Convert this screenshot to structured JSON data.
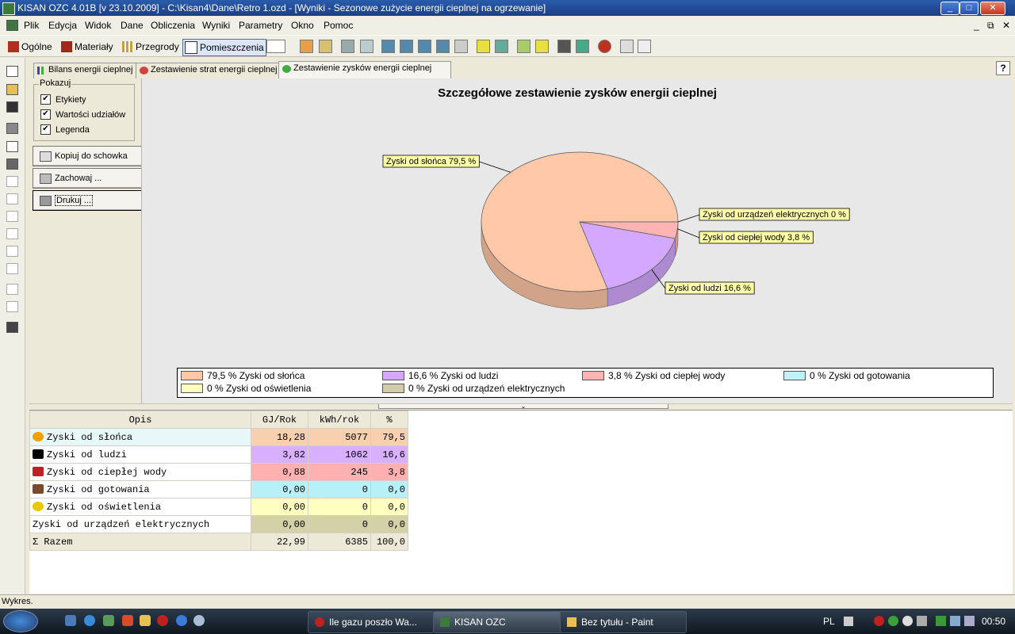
{
  "window": {
    "title": "KISAN OZC 4.01B [v 23.10.2009] - C:\\Kisan4\\Dane\\Retro 1.ozd - [Wyniki - Sezonowe zużycie energii cieplnej na ogrzewanie]"
  },
  "menu": [
    "Plik",
    "Edycja",
    "Widok",
    "Dane",
    "Obliczenia",
    "Wyniki",
    "Parametry",
    "Okno",
    "Pomoc"
  ],
  "toolbar": {
    "ogolne": "Ogólne",
    "materialy": "Materiały",
    "przegrody": "Przegrody",
    "pomieszczenia": "Pomieszczenia"
  },
  "tabs": [
    "Bilans energii cieplnej",
    "Zestawienie strat energii cieplnej",
    "Zestawienie zysków energii cieplnej"
  ],
  "help": "?",
  "options": {
    "group_label": "Pokazuj",
    "checks": [
      {
        "label": "Etykiety",
        "checked": true
      },
      {
        "label": "Wartości udziałów",
        "checked": true
      },
      {
        "label": "Legenda",
        "checked": true
      }
    ],
    "check_mark": "✔",
    "buttons": [
      "Kopiuj do schowka",
      "Zachowaj ...",
      "Drukuj ..."
    ]
  },
  "chart_data": {
    "type": "pie",
    "title": "Szczegółowe zestawienie zysków energii cieplnej",
    "slices": [
      {
        "name": "Zyski od słońca",
        "value": 79.5,
        "color": "#ffc8a8",
        "label": "Zyski od słońca 79,5 %",
        "legend": "79,5 % Zyski od słońca"
      },
      {
        "name": "Zyski od ludzi",
        "value": 16.6,
        "color": "#d4a8ff",
        "label": "Zyski od ludzi 16,6 %",
        "legend": "16,6 % Zyski od ludzi"
      },
      {
        "name": "Zyski od ciepłej wody",
        "value": 3.8,
        "color": "#ffb4b4",
        "label": "Zyski od ciepłej wody 3,8 %",
        "legend": "3,8 % Zyski od ciepłej wody"
      },
      {
        "name": "Zyski od gotowania",
        "value": 0,
        "color": "#c0f0f8",
        "label": "",
        "legend": "0 % Zyski od gotowania"
      },
      {
        "name": "Zyski od oświetlenia",
        "value": 0,
        "color": "#ffffc0",
        "label": "",
        "legend": "0 % Zyski od oświetlenia"
      },
      {
        "name": "Zyski od urządzeń elektrycznych",
        "value": 0,
        "color": "#d0ccaa",
        "label": "Zyski od urządzeń elektrycznych 0 %",
        "legend": "0 % Zyski od urządzeń elektrycznych"
      }
    ],
    "legend": true
  },
  "table": {
    "headers": [
      "Opis",
      "GJ/Rok",
      "kWh/rok",
      "%"
    ],
    "rows": [
      {
        "opis": "Zyski od słońca",
        "gj": "18,28",
        "kwh": "5077",
        "pct": "79,5",
        "bg": "#e8f8f8",
        "nbg": "#f8d0b0",
        "icon": "sun-icon",
        "ic": "#f0a000"
      },
      {
        "opis": "Zyski od ludzi",
        "gj": "3,82",
        "kwh": "1062",
        "pct": "16,6",
        "bg": "#ffffff",
        "nbg": "#d8b0ff",
        "icon": "person-icon",
        "ic": "#000000"
      },
      {
        "opis": "Zyski od ciepłej wody",
        "gj": "0,88",
        "kwh": "245",
        "pct": "3,8",
        "bg": "#ffffff",
        "nbg": "#ffb0b0",
        "icon": "faucet-icon",
        "ic": "#c02020"
      },
      {
        "opis": "Zyski od gotowania",
        "gj": "0,00",
        "kwh": "0",
        "pct": "0,0",
        "bg": "#ffffff",
        "nbg": "#b8f0f8",
        "icon": "stove-icon",
        "ic": "#7a4a2a"
      },
      {
        "opis": "Zyski od oświetlenia",
        "gj": "0,00",
        "kwh": "0",
        "pct": "0,0",
        "bg": "#ffffff",
        "nbg": "#ffffc0",
        "icon": "bulb-icon",
        "ic": "#e8c800"
      },
      {
        "opis": "Zyski od urządzeń elektrycznych",
        "gj": "0,00",
        "kwh": "0",
        "pct": "0,0",
        "bg": "#ffffff",
        "nbg": "#d4d0a8",
        "icon": "",
        "ic": ""
      }
    ],
    "total": {
      "opis": "Σ Razem",
      "gj": "22,99",
      "kwh": "6385",
      "pct": "100,0"
    }
  },
  "status": "Wykres.",
  "taskbar": {
    "items": [
      "Ile gazu poszło Wa...",
      "KISAN OZC",
      "Bez tytułu - Paint"
    ],
    "lang": "PL",
    "clock": "00:50"
  }
}
